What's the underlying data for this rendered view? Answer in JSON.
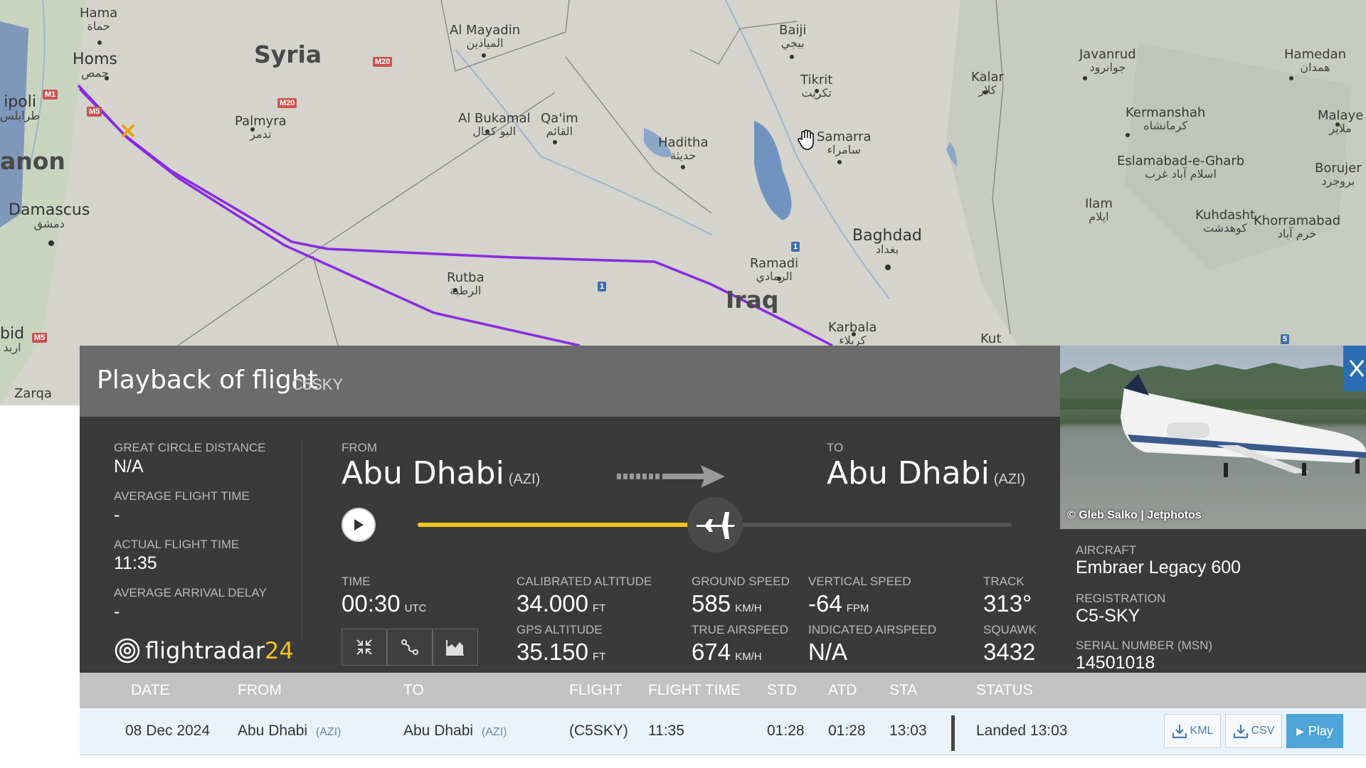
{
  "map": {
    "countries": [
      "Syria",
      "Iraq",
      "anon"
    ],
    "places": [
      {
        "name": "Hama",
        "ar": "حماة"
      },
      {
        "name": "Homs",
        "ar": "حمص"
      },
      {
        "name": "ipoli",
        "ar": "طرابلس"
      },
      {
        "name": "Damascus",
        "ar": "دمشق"
      },
      {
        "name": "bid",
        "ar": "اربد"
      },
      {
        "name": "Zarqa",
        "ar": ""
      },
      {
        "name": "Palmyra",
        "ar": "تدمر"
      },
      {
        "name": "Al Mayadin",
        "ar": "الميادين"
      },
      {
        "name": "Al Bukamal",
        "ar": "البو كمال"
      },
      {
        "name": "Qa'im",
        "ar": "القائم"
      },
      {
        "name": "Haditha",
        "ar": "حديثة"
      },
      {
        "name": "Baiji",
        "ar": "بيجي"
      },
      {
        "name": "Tikrit",
        "ar": "تكريت"
      },
      {
        "name": "Samarra",
        "ar": "سامراء"
      },
      {
        "name": "Baghdad",
        "ar": "بغداد"
      },
      {
        "name": "Ramadi",
        "ar": "الرمادي"
      },
      {
        "name": "Rutba",
        "ar": "الرطبة"
      },
      {
        "name": "Karbala",
        "ar": "كربلاء"
      },
      {
        "name": "Kut",
        "ar": ""
      },
      {
        "name": "Kalar",
        "ar": "كلار"
      },
      {
        "name": "Javanrud",
        "ar": "جوانرود"
      },
      {
        "name": "Kermanshah",
        "ar": "کرمانشاه"
      },
      {
        "name": "Eslamabad-e-Gharb",
        "ar": "اسلام آباد غرب"
      },
      {
        "name": "Ilam",
        "ar": "ایلام"
      },
      {
        "name": "Kuhdasht",
        "ar": "کوهدشت"
      },
      {
        "name": "Khorramabad",
        "ar": "خرم آباد"
      },
      {
        "name": "Hamedan",
        "ar": "همدان"
      },
      {
        "name": "Malaye",
        "ar": "ملاير"
      },
      {
        "name": "Borujer",
        "ar": "بروجرد"
      }
    ],
    "roads": [
      "M1",
      "M5",
      "M20",
      "M20",
      "M5",
      "1",
      "1",
      "5"
    ]
  },
  "header": {
    "title": "Playback of flight",
    "callsign": "C5SKY"
  },
  "stats": {
    "gcd_label": "GREAT CIRCLE DISTANCE",
    "gcd_value": "N/A",
    "aft_label": "AVERAGE FLIGHT TIME",
    "aft_value": "-",
    "act_label": "ACTUAL FLIGHT TIME",
    "act_value": "11:35",
    "aad_label": "AVERAGE ARRIVAL DELAY",
    "aad_value": "-"
  },
  "route": {
    "from_label": "FROM",
    "from_city": "Abu Dhabi",
    "from_iata": "(AZI)",
    "to_label": "TO",
    "to_city": "Abu Dhabi",
    "to_iata": "(AZI)"
  },
  "playback": {
    "progress": 0.5
  },
  "telemetry": {
    "time_label": "TIME",
    "time_value": "00:30",
    "time_unit": "UTC",
    "cal_alt_label": "CALIBRATED ALTITUDE",
    "cal_alt_value": "34.000",
    "cal_alt_unit": "FT",
    "gps_alt_label": "GPS ALTITUDE",
    "gps_alt_value": "35.150",
    "gps_alt_unit": "FT",
    "gs_label": "GROUND SPEED",
    "gs_value": "585",
    "gs_unit": "KM/H",
    "tas_label": "TRUE AIRSPEED",
    "tas_value": "674",
    "tas_unit": "KM/H",
    "vs_label": "VERTICAL SPEED",
    "vs_value": "-64",
    "vs_unit": "FPM",
    "ias_label": "INDICATED AIRSPEED",
    "ias_value": "N/A",
    "track_label": "TRACK",
    "track_value": "313°",
    "squawk_label": "SQUAWK",
    "squawk_value": "3432"
  },
  "logo": {
    "name": "flightradar",
    "num": "24"
  },
  "aircraft": {
    "photo_credit": "© Gleb Salko | Jetphotos",
    "aircraft_label": "AIRCRAFT",
    "aircraft_value": "Embraer Legacy 600",
    "reg_label": "REGISTRATION",
    "reg_value": "C5-SKY",
    "msn_label": "SERIAL NUMBER (MSN)",
    "msn_value": "14501018"
  },
  "table": {
    "headers": [
      "DATE",
      "FROM",
      "TO",
      "FLIGHT",
      "FLIGHT TIME",
      "STD",
      "ATD",
      "STA",
      "STATUS"
    ],
    "row": {
      "date": "08 Dec 2024",
      "from": "Abu Dhabi",
      "from_iata": "(AZI)",
      "to": "Abu Dhabi",
      "to_iata": "(AZI)",
      "flight": "(C5SKY)",
      "flight_time": "11:35",
      "std": "01:28",
      "atd": "01:28",
      "sta": "13:03",
      "status": "Landed 13:03",
      "kml": "KML",
      "csv": "CSV",
      "play": "Play"
    }
  },
  "colors": {
    "accent": "#f2c21f",
    "track": "#8a2be2",
    "panel": "#3a3a3a",
    "header": "#6b6b6b"
  }
}
